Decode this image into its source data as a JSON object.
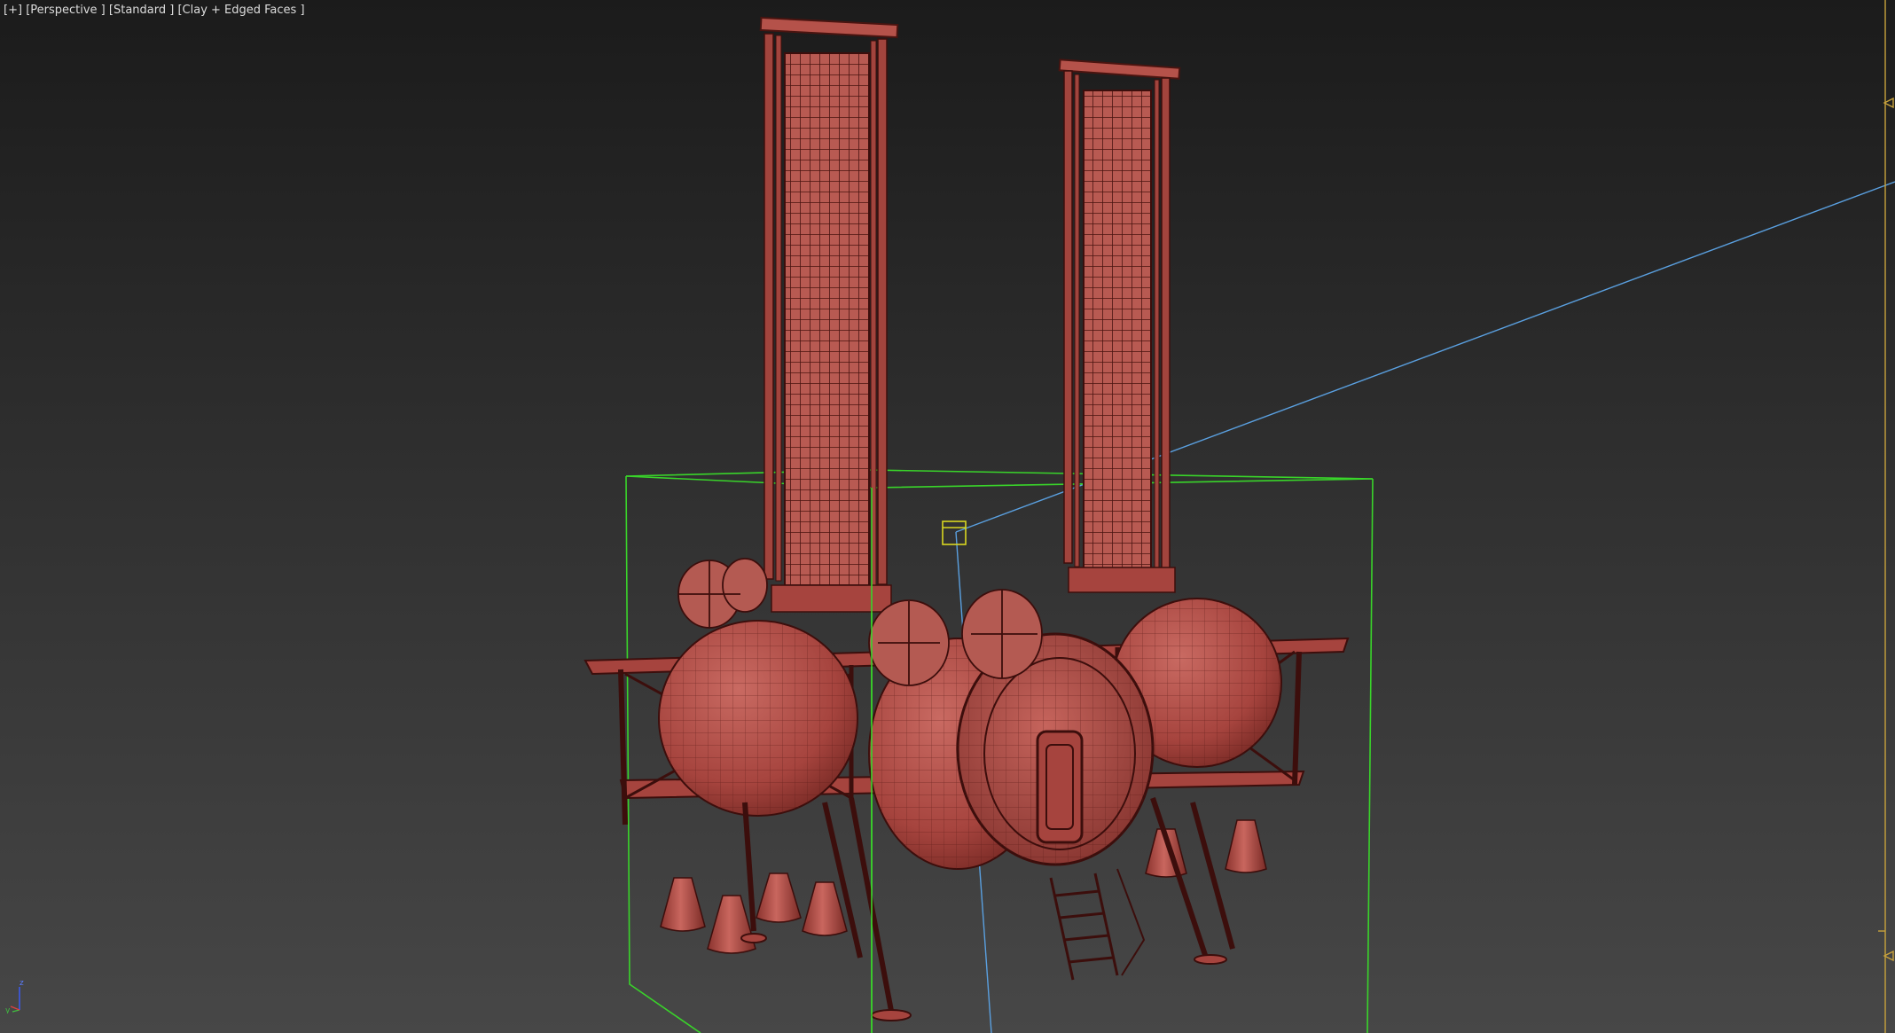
{
  "viewport": {
    "label_plus": "[+]",
    "label_view": "[Perspective ]",
    "label_shading_mode": "[Standard ]",
    "label_display": "[Clay + Edged Faces ]",
    "axis_x": "x",
    "axis_y": "y",
    "axis_z": "z"
  },
  "colors": {
    "model": "#b24f48",
    "model_dark": "#6a2420",
    "wire": "#3c0e0c",
    "bbox": "#39d42a",
    "target_line": "#5aa0e0",
    "light_icon": "#d9d820",
    "marker": "#c8a23c"
  },
  "icons": [
    "light-icon",
    "target-line",
    "axis-tripod-icon",
    "frame-marker-icon"
  ]
}
